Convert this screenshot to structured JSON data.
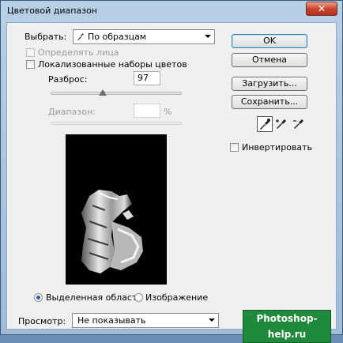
{
  "window": {
    "title": "Цветовой диапазон",
    "close_label": "✕"
  },
  "select": {
    "label": "Выбрать:",
    "value": "По образцам"
  },
  "options": {
    "detect_faces_label": "Определять лица",
    "localized_clusters_label": "Локализованные наборы цветов"
  },
  "fuzziness": {
    "label": "Разброс:",
    "value": "97",
    "level_fraction": 0.4
  },
  "range": {
    "label": "Диапазон:",
    "value": "",
    "unit": "%"
  },
  "preview_mode": {
    "selection_label": "Выделенная область",
    "image_label": "Изображение",
    "selected": "selection"
  },
  "selection_preview": {
    "label": "Просмотр:",
    "value": "Не показывать"
  },
  "buttons": {
    "ok": "OK",
    "cancel": "Отмена",
    "load": "Загрузить...",
    "save": "Сохранить..."
  },
  "invert_label": "Инвертировать",
  "icons": [
    "eyedropper-icon",
    "eyedropper-plus-icon",
    "eyedropper-minus-icon",
    "eyedropper-small-icon"
  ],
  "watermark": "Photoshop-help.ru",
  "colors": {
    "watermark_bg": "#1f8a3c",
    "default_button_border": "#3c7fb1"
  }
}
